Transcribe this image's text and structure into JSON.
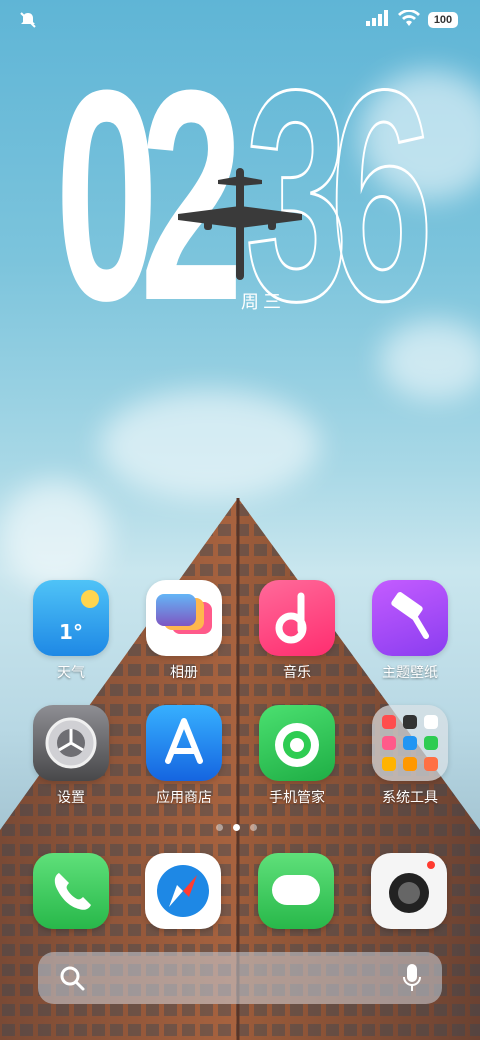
{
  "status_bar": {
    "battery": "100",
    "icons": [
      "mute-icon",
      "signal-icon",
      "wifi-icon",
      "battery-icon"
    ]
  },
  "clock": {
    "hours": "02",
    "minutes": "36",
    "weekday": "周三"
  },
  "apps_row1": [
    {
      "label": "天气",
      "icon": "weather-icon",
      "badge": "1°"
    },
    {
      "label": "相册",
      "icon": "gallery-icon"
    },
    {
      "label": "音乐",
      "icon": "music-icon"
    },
    {
      "label": "主题壁纸",
      "icon": "theme-icon"
    }
  ],
  "apps_row2": [
    {
      "label": "设置",
      "icon": "settings-icon"
    },
    {
      "label": "应用商店",
      "icon": "app-store-icon"
    },
    {
      "label": "手机管家",
      "icon": "phone-manager-icon"
    },
    {
      "label": "系统工具",
      "icon": "system-tools-folder-icon"
    }
  ],
  "dock": [
    "phone-icon",
    "browser-icon",
    "messages-icon",
    "camera-icon"
  ],
  "page_indicator": {
    "pages": 3,
    "current": 2
  },
  "colors": {
    "sky": "#7cc4dc",
    "weather": "#2fa8f0",
    "music": "#ff3d7f",
    "theme": "#a64cf0",
    "store": "#1f88f5",
    "manager": "#2ecc52",
    "phone": "#34c759",
    "camera_dot": "#ff3b30"
  }
}
